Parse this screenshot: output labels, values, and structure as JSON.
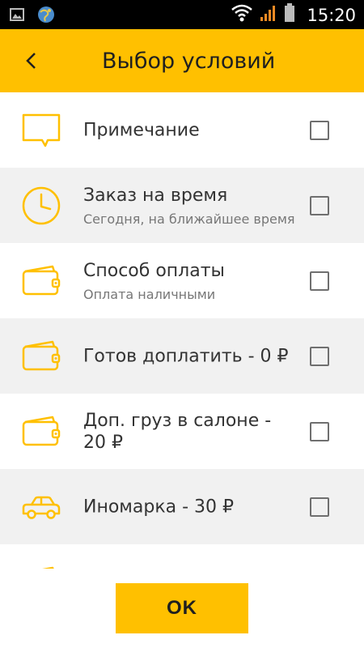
{
  "status_bar": {
    "time": "15:20",
    "icons": [
      "image-icon",
      "globe-icon",
      "wifi-icon",
      "signal-icon",
      "battery-icon"
    ]
  },
  "header": {
    "title": "Выбор условий",
    "back_icon": "chevron-left-icon"
  },
  "colors": {
    "accent": "#ffc000",
    "row_alt": "#f1f1f1",
    "icon": "#ffc000",
    "checkbox": "#6f6f6f"
  },
  "options": [
    {
      "icon": "comment-icon",
      "label": "Примечание",
      "sublabel": "",
      "checked": false
    },
    {
      "icon": "clock-icon",
      "label": "Заказ на время",
      "sublabel": "Сегодня, на ближайшее время",
      "checked": false
    },
    {
      "icon": "wallet-icon",
      "label": "Способ оплаты",
      "sublabel": "Оплата наличными",
      "checked": false
    },
    {
      "icon": "wallet-icon",
      "label": "Готов доплатить - 0 ₽",
      "sublabel": "",
      "checked": false
    },
    {
      "icon": "wallet-icon",
      "label": "Доп. груз в салоне - 20 ₽",
      "sublabel": "",
      "checked": false
    },
    {
      "icon": "car-icon",
      "label": "Иномарка - 30 ₽",
      "sublabel": "",
      "checked": false
    },
    {
      "icon": "wallet-icon",
      "label": "",
      "sublabel": "",
      "checked": false
    }
  ],
  "footer": {
    "ok_label": "OK"
  }
}
